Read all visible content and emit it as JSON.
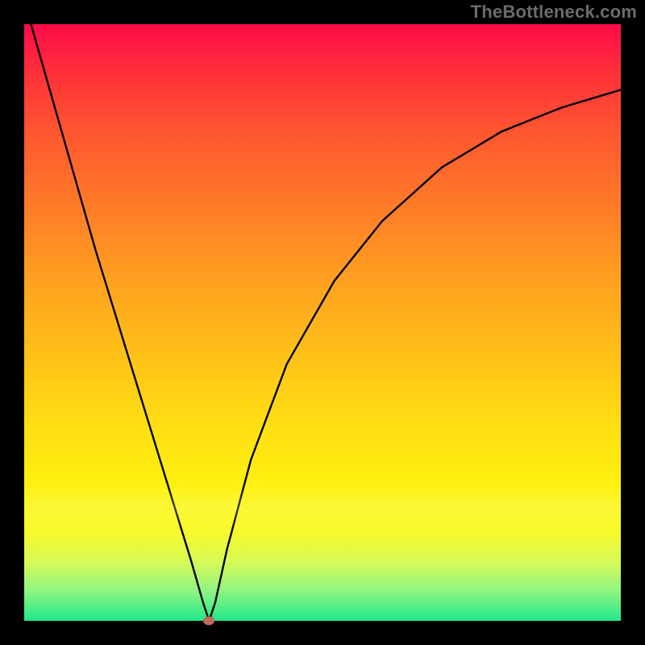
{
  "watermark": "TheBottleneck.com",
  "colors": {
    "gradient_top": "#ff0b48",
    "gradient_bottom": "#1fe98a",
    "curve": "#000000",
    "marker": "#c46a5c",
    "frame": "#000000"
  },
  "chart_data": {
    "type": "line",
    "title": "",
    "xlabel": "",
    "ylabel": "",
    "xlim": [
      0,
      100
    ],
    "ylim": [
      0,
      100
    ],
    "grid": false,
    "legend": false,
    "annotations": [
      "TheBottleneck.com"
    ],
    "series": [
      {
        "name": "bottleneck-curve",
        "x": [
          0,
          4,
          8,
          12,
          16,
          20,
          24,
          28,
          30,
          31,
          32,
          34,
          38,
          44,
          52,
          60,
          70,
          80,
          90,
          100
        ],
        "values": [
          104,
          90,
          76,
          62,
          49,
          36,
          23,
          10,
          3,
          0,
          3,
          12,
          27,
          43,
          57,
          67,
          76,
          82,
          86,
          89
        ]
      }
    ],
    "optimal_point": {
      "x": 31,
      "y": 0
    }
  }
}
